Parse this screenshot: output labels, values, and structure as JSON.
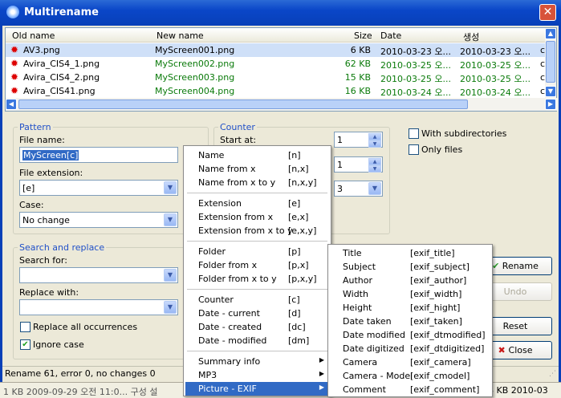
{
  "window": {
    "title": "Multirename"
  },
  "columns": {
    "old_name": "Old name",
    "new_name": "New name",
    "size": "Size",
    "date": "Date",
    "created": "생성"
  },
  "rows": [
    {
      "old": "AV3.png",
      "new": "MyScreen001.png",
      "size": "6 KB",
      "date": "2010-03-23 오...",
      "created": "2010-03-23 오..."
    },
    {
      "old": "Avira_CIS4_1.png",
      "new": "MyScreen002.png",
      "size": "62 KB",
      "date": "2010-03-25 오...",
      "created": "2010-03-25 오..."
    },
    {
      "old": "Avira_CIS4_2.png",
      "new": "MyScreen003.png",
      "size": "15 KB",
      "date": "2010-03-25 오...",
      "created": "2010-03-25 오..."
    },
    {
      "old": "Avira_CIS41.png",
      "new": "MyScreen004.png",
      "size": "16 KB",
      "date": "2010-03-24 오...",
      "created": "2010-03-24 오..."
    }
  ],
  "overflow_char": "c",
  "pattern": {
    "label": "Pattern",
    "file_name_label": "File name:",
    "file_name_value": "MyScreen[c]",
    "ext_label": "File extension:",
    "ext_value": "[e]",
    "case_label": "Case:",
    "case_value": "No change"
  },
  "counter": {
    "label": "Counter",
    "start_label": "Start at:",
    "start_value": "1",
    "step_value": "1",
    "digits_value": "3"
  },
  "options": {
    "subdirs": "With subdirectories",
    "only_files": "Only files"
  },
  "search": {
    "label": "Search and replace",
    "search_label": "Search for:",
    "replace_label": "Replace with:",
    "replace_all": "Replace all occurrences",
    "ignore_case": "Ignore case"
  },
  "buttons": {
    "rename": "Rename",
    "undo": "Undo",
    "reset": "Reset",
    "close": "Close"
  },
  "status": "Rename 61, error 0, no changes 0",
  "bottom_strip": {
    "left": "1 KB   2009-09-29 오전 11:0...   구성 설",
    "right": "8 KB  2010-03"
  },
  "menu": [
    {
      "label": "Name",
      "code": "[n]"
    },
    {
      "label": "Name from x",
      "code": "[n,x]"
    },
    {
      "label": "Name from x to y",
      "code": "[n,x,y]"
    },
    {
      "label": "Extension",
      "code": "[e]"
    },
    {
      "label": "Extension from x",
      "code": "[e,x]"
    },
    {
      "label": "Extension from x to y",
      "code": "[e,x,y]"
    },
    {
      "label": "Folder",
      "code": "[p]"
    },
    {
      "label": "Folder from x",
      "code": "[p,x]"
    },
    {
      "label": "Folder from x to y",
      "code": "[p,x,y]"
    },
    {
      "label": "Counter",
      "code": "[c]"
    },
    {
      "label": "Date - current",
      "code": "[d]"
    },
    {
      "label": "Date - created",
      "code": "[dc]"
    },
    {
      "label": "Date - modified",
      "code": "[dm]"
    },
    {
      "label": "Summary info",
      "code": ""
    },
    {
      "label": "MP3",
      "code": ""
    },
    {
      "label": "Picture - EXIF",
      "code": ""
    }
  ],
  "submenu": [
    {
      "label": "Title",
      "code": "[exif_title]"
    },
    {
      "label": "Subject",
      "code": "[exif_subject]"
    },
    {
      "label": "Author",
      "code": "[exif_author]"
    },
    {
      "label": "Width",
      "code": "[exif_width]"
    },
    {
      "label": "Height",
      "code": "[exif_hight]"
    },
    {
      "label": "Date taken",
      "code": "[exif_taken]"
    },
    {
      "label": "Date modified",
      "code": "[exif_dtmodified]"
    },
    {
      "label": "Date digitized",
      "code": "[exif_dtdigitized]"
    },
    {
      "label": "Camera",
      "code": "[exif_camera]"
    },
    {
      "label": "Camera - Model",
      "code": "[exif_cmodel]"
    },
    {
      "label": "Comment",
      "code": "[exif_comment]"
    }
  ]
}
